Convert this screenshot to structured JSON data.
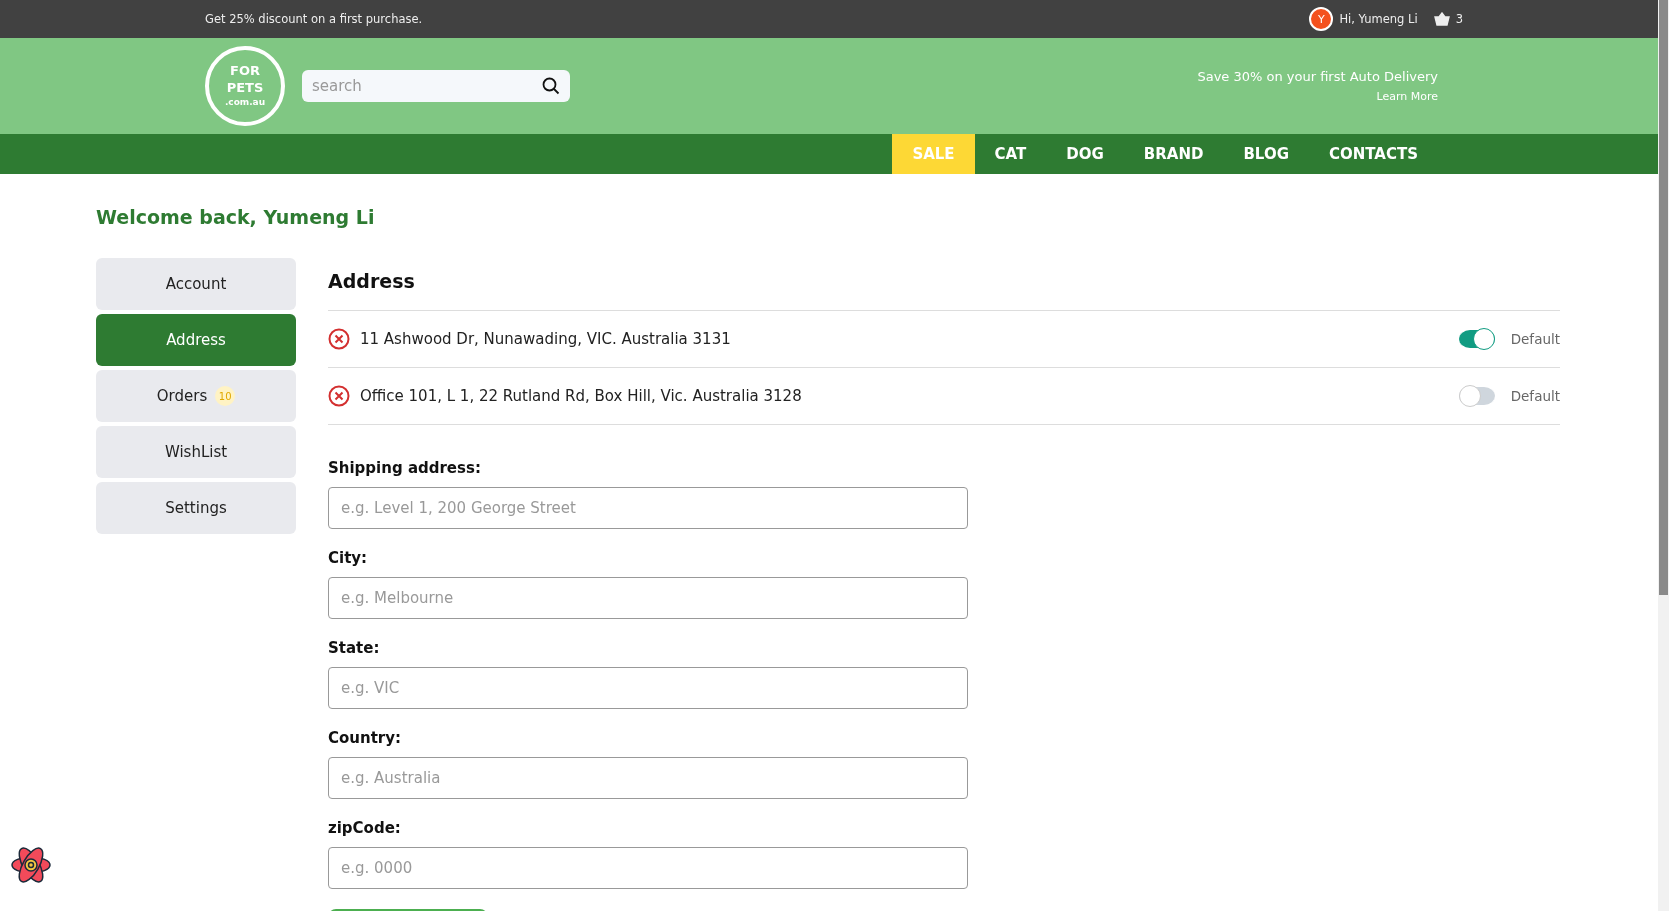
{
  "top_bar": {
    "promo": "Get 25% discount on a first purchase.",
    "avatar_initial": "Y",
    "greeting": "Hi, Yumeng Li",
    "cart_count": "3"
  },
  "header": {
    "logo": [
      "FOR",
      "PETS",
      ".com.au"
    ],
    "search": {
      "placeholder": "search"
    },
    "offer": "Save 30% on your first Auto Delivery",
    "offer_link": "Learn More"
  },
  "nav": [
    {
      "label": "SALE",
      "selected": true
    },
    {
      "label": "CAT",
      "selected": false
    },
    {
      "label": "DOG",
      "selected": false
    },
    {
      "label": "BRAND",
      "selected": false
    },
    {
      "label": "BLOG",
      "selected": false
    },
    {
      "label": "CONTACTS",
      "selected": false
    }
  ],
  "welcome": "Welcome back, Yumeng Li",
  "sidebar": [
    {
      "label": "Account",
      "selected": false
    },
    {
      "label": "Address",
      "selected": true
    },
    {
      "label": "Orders",
      "badge": "10",
      "selected": false
    },
    {
      "label": "WishList",
      "selected": false
    },
    {
      "label": "Settings",
      "selected": false
    }
  ],
  "section_title": "Address",
  "addresses": [
    {
      "text": "11 Ashwood Dr, Nunawading, VIC. Australia 3131",
      "on": true,
      "toggle_label": "Default"
    },
    {
      "text": "Office 101, L 1, 22 Rutland Rd, Box Hill, Vic. Australia 3128",
      "on": false,
      "toggle_label": "Default"
    }
  ],
  "form": [
    {
      "label": "Shipping address:",
      "placeholder": "e.g. Level 1, 200 George Street"
    },
    {
      "label": "City:",
      "placeholder": "e.g. Melbourne"
    },
    {
      "label": "State:",
      "placeholder": "e.g. VIC"
    },
    {
      "label": "Country:",
      "placeholder": "e.g. Australia"
    },
    {
      "label": "zipCode:",
      "placeholder": "e.g. 0000"
    }
  ]
}
